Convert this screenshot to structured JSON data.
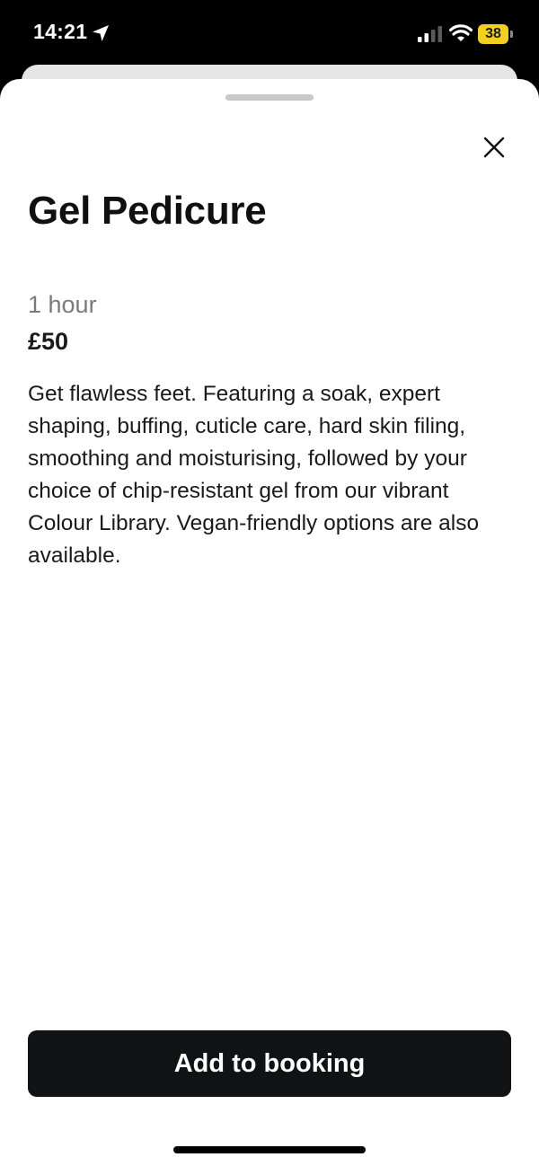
{
  "status_bar": {
    "time": "14:21",
    "battery_level": "38",
    "icons": [
      "location-arrow-icon",
      "cellular-signal-icon",
      "wifi-icon",
      "battery-icon"
    ],
    "battery_color": "#f4cf1b"
  },
  "sheet": {
    "title": "Gel Pedicure",
    "duration": "1 hour",
    "price": "£50",
    "description": "Get flawless feet. Featuring a soak, expert shaping, buffing, cuticle care, hard skin filing, smoothing and moisturising, followed by your choice of chip-resistant gel from our vibrant Colour Library. Vegan-friendly options are also available.",
    "close_icon": "close-icon",
    "primary_button_label": "Add to booking"
  },
  "colors": {
    "button_background": "#101214",
    "text_primary": "#101010",
    "text_secondary": "#7a7a7a"
  }
}
